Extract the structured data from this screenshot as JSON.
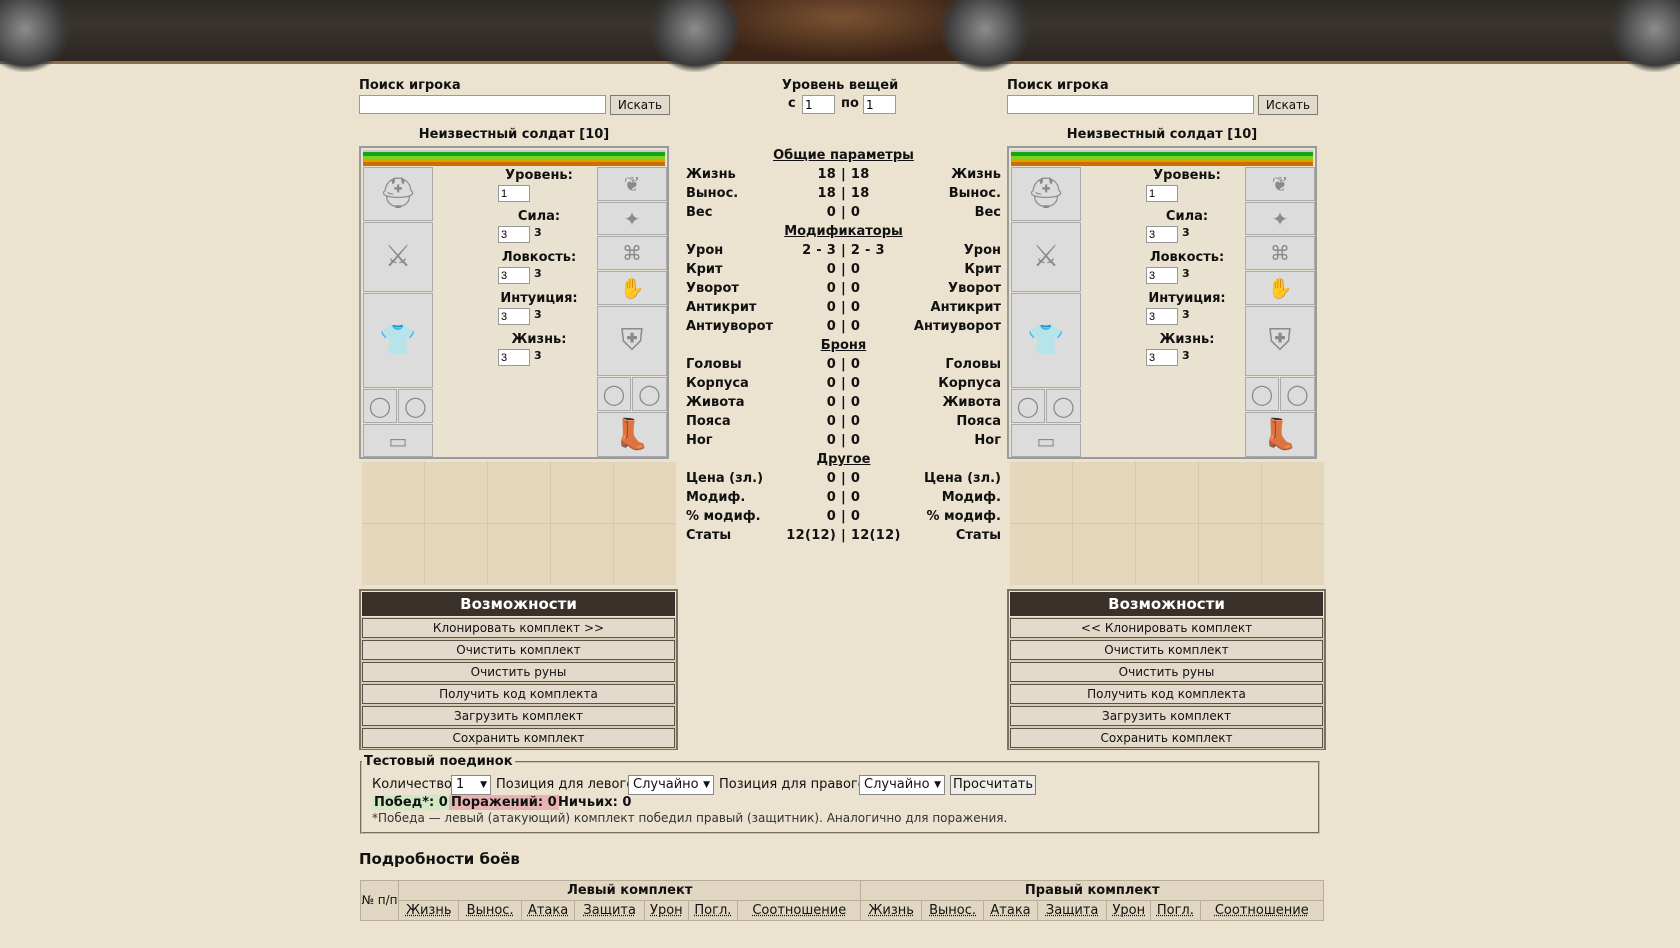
{
  "search_left": {
    "label": "Поиск игрока",
    "button": "Искать",
    "value": ""
  },
  "search_right": {
    "label": "Поиск игрока",
    "button": "Искать",
    "value": ""
  },
  "item_level": {
    "label": "Уровень вещей",
    "from_label": "с",
    "from_value": "1",
    "to_label": "по",
    "to_value": "1"
  },
  "left": {
    "name": "Неизвестный солдат [10]",
    "stats": [
      {
        "label": "Уровень:",
        "value": "1",
        "extra": ""
      },
      {
        "label": "Сила:",
        "value": "3",
        "extra": "3"
      },
      {
        "label": "Ловкость:",
        "value": "3",
        "extra": "3"
      },
      {
        "label": "Интуиция:",
        "value": "3",
        "extra": "3"
      },
      {
        "label": "Жизнь:",
        "value": "3",
        "extra": "3"
      }
    ],
    "options_title": "Возможности",
    "options": [
      "Клонировать комплект >>",
      "Очистить комплект",
      "Очистить руны",
      "Получить код комплекта",
      "Загрузить комплект",
      "Сохранить комплект"
    ]
  },
  "right": {
    "name": "Неизвестный солдат [10]",
    "stats": [
      {
        "label": "Уровень:",
        "value": "1",
        "extra": ""
      },
      {
        "label": "Сила:",
        "value": "3",
        "extra": "3"
      },
      {
        "label": "Ловкость:",
        "value": "3",
        "extra": "3"
      },
      {
        "label": "Интуиция:",
        "value": "3",
        "extra": "3"
      },
      {
        "label": "Жизнь:",
        "value": "3",
        "extra": "3"
      }
    ],
    "options_title": "Возможности",
    "options": [
      "<< Клонировать комплект",
      "Очистить комплект",
      "Очистить руны",
      "Получить код комплекта",
      "Загрузить комплект",
      "Сохранить комплект"
    ]
  },
  "compare": {
    "sections": [
      {
        "title": "Общие параметры",
        "rows": [
          [
            "Жизнь",
            "18 | 18",
            "Жизнь"
          ],
          [
            "Вынос.",
            "18 | 18",
            "Вынос."
          ],
          [
            "Вес",
            "0 | 0",
            "Вес"
          ]
        ]
      },
      {
        "title": "Модификаторы",
        "rows": [
          [
            "Урон",
            "2 - 3 | 2 - 3",
            "Урон"
          ],
          [
            "Крит",
            "0 | 0",
            "Крит"
          ],
          [
            "Уворот",
            "0 | 0",
            "Уворот"
          ],
          [
            "Антикрит",
            "0 | 0",
            "Антикрит"
          ],
          [
            "Антиуворот",
            "0 | 0",
            "Антиуворот"
          ]
        ]
      },
      {
        "title": "Броня",
        "rows": [
          [
            "Головы",
            "0 | 0",
            "Головы"
          ],
          [
            "Корпуса",
            "0 | 0",
            "Корпуса"
          ],
          [
            "Живота",
            "0 | 0",
            "Живота"
          ],
          [
            "Пояса",
            "0 | 0",
            "Пояса"
          ],
          [
            "Ног",
            "0 | 0",
            "Ног"
          ]
        ]
      },
      {
        "title": "Другое",
        "rows": [
          [
            "Цена (зл.)",
            "0 | 0",
            "Цена (зл.)"
          ],
          [
            "Модиф.",
            "0 | 0",
            "Модиф."
          ],
          [
            "% модиф.",
            "0 | 0",
            "% модиф."
          ],
          [
            "Статы",
            "12(12) | 12(12)",
            "Статы"
          ]
        ]
      }
    ]
  },
  "duel": {
    "legend": "Тестовый поединок",
    "count_label": "Количество:",
    "count_value": "1",
    "left_pos_label": "Позиция для левого:",
    "left_pos_value": "Случайно",
    "right_pos_label": "Позиция для правого:",
    "right_pos_value": "Случайно",
    "calc_button": "Просчитать",
    "wins": "Побед*: 0",
    "losses": "Поражений: 0",
    "draws": "Ничьих: 0",
    "note": "*Победа — левый (атакующий) комплект победил правый (защитник). Аналогично для поражения."
  },
  "details": {
    "title": "Подробности боёв",
    "num_header": "№ п/п",
    "left_header": "Левый комплект",
    "right_header": "Правый комплект",
    "columns": [
      "Жизнь",
      "Вынос.",
      "Атака",
      "Защита",
      "Урон",
      "Погл.",
      "Соотношение"
    ]
  },
  "colors": {
    "background": "#ebe2cf",
    "header_dark": "#3a322a",
    "hp_green": "#16a51a",
    "hp_orange": "#e0a000",
    "win_bg": "#cfe9c5",
    "loss_bg": "#e8b3b3"
  }
}
